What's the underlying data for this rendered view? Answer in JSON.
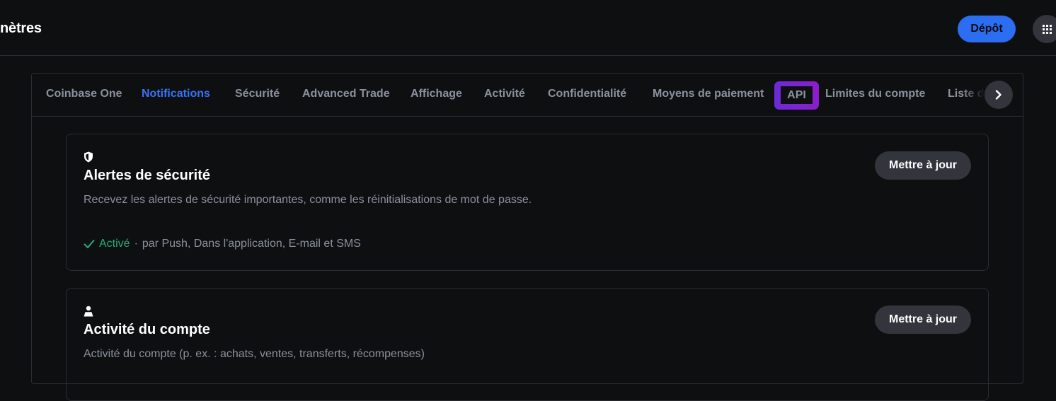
{
  "header": {
    "title": "nètres",
    "deposit_label": "Dépôt",
    "apps_icon": "grid-icon"
  },
  "tabs": [
    {
      "label": "Coinbase One",
      "active": false
    },
    {
      "label": "Notifications",
      "active": true
    },
    {
      "label": "Sécurité",
      "active": false
    },
    {
      "label": "Advanced Trade",
      "active": false
    },
    {
      "label": "Affichage",
      "active": false
    },
    {
      "label": "Activité",
      "active": false
    },
    {
      "label": "Confidentialité",
      "active": false
    },
    {
      "label": "Moyens de paiement",
      "active": false
    },
    {
      "label": "API",
      "active": false,
      "highlighted": true
    },
    {
      "label": "Limites du compte",
      "active": false
    },
    {
      "label": "Liste d",
      "active": false
    }
  ],
  "tabs_scroll_icon": "chevron-right-icon",
  "cards": [
    {
      "icon": "shield-icon",
      "title": "Alertes de sécurité",
      "description": "Recevez les alertes de sécurité importantes, comme les réinitialisations de mot de passe.",
      "button_label": "Mettre à jour",
      "status": {
        "icon": "check-icon",
        "state": "Activé",
        "separator": "·",
        "detail": "par Push, Dans l'application, E-mail et SMS"
      }
    },
    {
      "icon": "user-icon",
      "title": "Activité du compte",
      "description": "Activité du compte (p. ex. : achats, ventes, transferts, récompenses)",
      "button_label": "Mettre à jour"
    }
  ],
  "colors": {
    "accent_blue": "#3773f5",
    "deposit_blue": "#2b6ef2",
    "status_green": "#27ad75",
    "highlight_purple": "#7a25d0",
    "background": "#0e0f11"
  }
}
